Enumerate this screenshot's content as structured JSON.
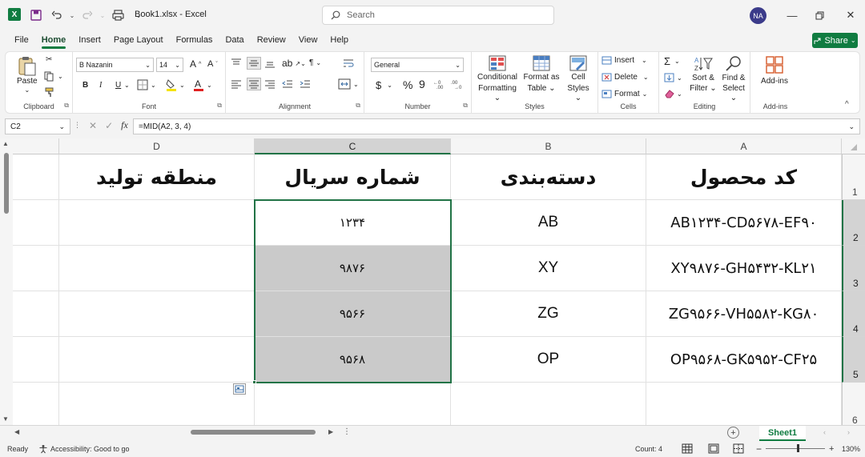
{
  "title_bar": {
    "app_badge": "X",
    "doc_title": "Book1.xlsx  -  Excel",
    "search_placeholder": "Search",
    "user_initials": "NA"
  },
  "menu": {
    "tabs": [
      "File",
      "Home",
      "Insert",
      "Page Layout",
      "Formulas",
      "Data",
      "Review",
      "View",
      "Help"
    ],
    "active": "Home",
    "share_label": "Share"
  },
  "ribbon": {
    "clipboard": {
      "label": "Clipboard",
      "paste": "Paste"
    },
    "font": {
      "label": "Font",
      "font_name": "B Nazanin",
      "font_size": "14",
      "bold": "B",
      "italic": "I",
      "underline": "U"
    },
    "alignment": {
      "label": "Alignment"
    },
    "number": {
      "label": "Number",
      "format": "General",
      "currency": "$",
      "percent": "%",
      "comma": "9"
    },
    "styles": {
      "label": "Styles",
      "conditional_1": "Conditional",
      "conditional_2": "Formatting",
      "format_table_1": "Format as",
      "format_table_2": "Table",
      "cell_styles_1": "Cell",
      "cell_styles_2": "Styles"
    },
    "cells": {
      "label": "Cells",
      "insert": "Insert",
      "delete": "Delete",
      "format": "Format"
    },
    "editing": {
      "label": "Editing",
      "sort_1": "Sort &",
      "sort_2": "Filter",
      "find_1": "Find &",
      "find_2": "Select"
    },
    "addins": {
      "label": "Add-ins",
      "button": "Add-ins"
    }
  },
  "formula_bar": {
    "name_box": "C2",
    "fx_label": "fx",
    "formula": "=MID(A2, 3, 4)"
  },
  "grid": {
    "columns": [
      "D",
      "C",
      "B",
      "A"
    ],
    "selected_column": "C",
    "rows": [
      "1",
      "2",
      "3",
      "4",
      "5",
      "6"
    ],
    "headers": {
      "A": "کد محصول",
      "B": "دسته‌بندی",
      "C": "شماره سریال",
      "D": "منطقه تولید"
    },
    "data": [
      {
        "A": "AB۱۲۳۴-CD۵۶۷۸-EF۹۰",
        "B": "AB",
        "C": "۱۲۳۴"
      },
      {
        "A": "XY۹۸۷۶-GH۵۴۳۲-KL۲۱",
        "B": "XY",
        "C": "۹۸۷۶"
      },
      {
        "A": "ZG۹۵۶۶-VH۵۵۸۲-KG۸۰",
        "B": "ZG",
        "C": "۹۵۶۶"
      },
      {
        "A": "OP۹۵۶۸-GK۵۹۵۲-CF۲۵",
        "B": "OP",
        "C": "۹۵۶۸"
      }
    ]
  },
  "sheets": {
    "tabs": [
      "Sheet1"
    ],
    "active": "Sheet1"
  },
  "status": {
    "ready": "Ready",
    "accessibility": "Accessibility: Good to go",
    "count": "Count: 4",
    "zoom": "130%"
  },
  "colors": {
    "accent": "#107c41",
    "selection_border": "#217346",
    "selected_fill": "#cacaca"
  }
}
